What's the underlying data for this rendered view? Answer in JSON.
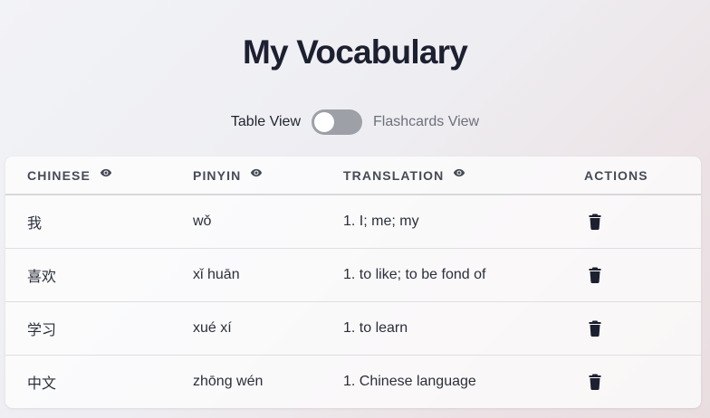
{
  "page": {
    "title": "My Vocabulary"
  },
  "view_toggle": {
    "left_label": "Table View",
    "right_label": "Flashcards View",
    "state": "table"
  },
  "table": {
    "headers": {
      "chinese": "CHINESE",
      "pinyin": "PINYIN",
      "translation": "TRANSLATION",
      "actions": "ACTIONS"
    },
    "header_icons": {
      "chinese": "eye-icon",
      "pinyin": "eye-icon",
      "translation": "eye-icon"
    },
    "row_action_icon": "trash-icon",
    "rows": [
      {
        "chinese": "我",
        "pinyin": "wǒ",
        "translation": "1. I; me; my"
      },
      {
        "chinese": "喜欢",
        "pinyin": "xǐ huān",
        "translation": "1. to like; to be fond of"
      },
      {
        "chinese": "学习",
        "pinyin": "xué xí",
        "translation": "1. to learn"
      },
      {
        "chinese": "中文",
        "pinyin": "zhōng wén",
        "translation": "1. Chinese language"
      }
    ]
  },
  "colors": {
    "title": "#1c2030",
    "toggle_track": "#9ea0a7",
    "icon": "#1c2030"
  }
}
